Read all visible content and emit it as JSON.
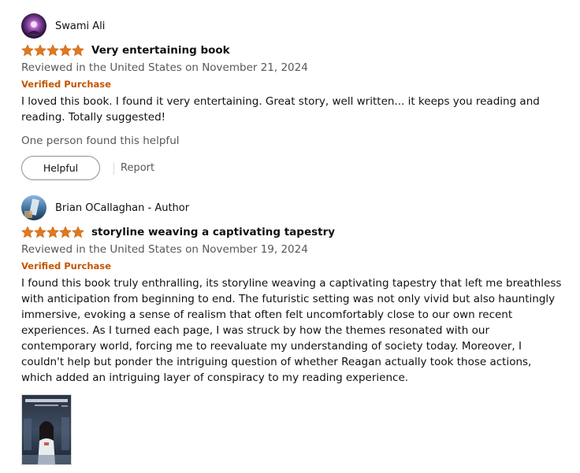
{
  "colors": {
    "star": "#de7921",
    "verified": "#c45500",
    "secondary_text": "#565959",
    "primary_text": "#0f1111"
  },
  "reviews": [
    {
      "profile_name": "Swami Ali",
      "avatar_icon": "user-avatar-icon",
      "rating": 5,
      "title": "Very entertaining book",
      "date": "Reviewed in the United States on November 21, 2024",
      "verified": "Verified Purchase",
      "body": "I loved this book. I found it very entertaining. Great story, well written... it keeps you reading and reading. Totally suggested!",
      "helpful_count": "One person found this helpful",
      "helpful_label": "Helpful",
      "report_label": "Report"
    },
    {
      "profile_name": "Brian OCallaghan - Author",
      "avatar_icon": "user-avatar-icon",
      "rating": 5,
      "title": "storyline weaving a captivating tapestry",
      "date": "Reviewed in the United States on November 19, 2024",
      "verified": "Verified Purchase",
      "body": "I found this book truly enthralling, its storyline weaving a captivating tapestry that left me breathless with anticipation from beginning to end. The futuristic setting was not only vivid but also hauntingly immersive, evoking a sense of realism that often felt uncomfortably close to our own recent experiences. As I turned each page, I was struck by how the themes resonated with our contemporary world, forcing me to reevaluate my understanding of society today. Moreover, I couldn't help but ponder the intriguing question of whether Reagan actually took those actions, which added an intriguing layer of conspiracy to my reading experience.",
      "image_icon": "book-cover-image"
    }
  ]
}
